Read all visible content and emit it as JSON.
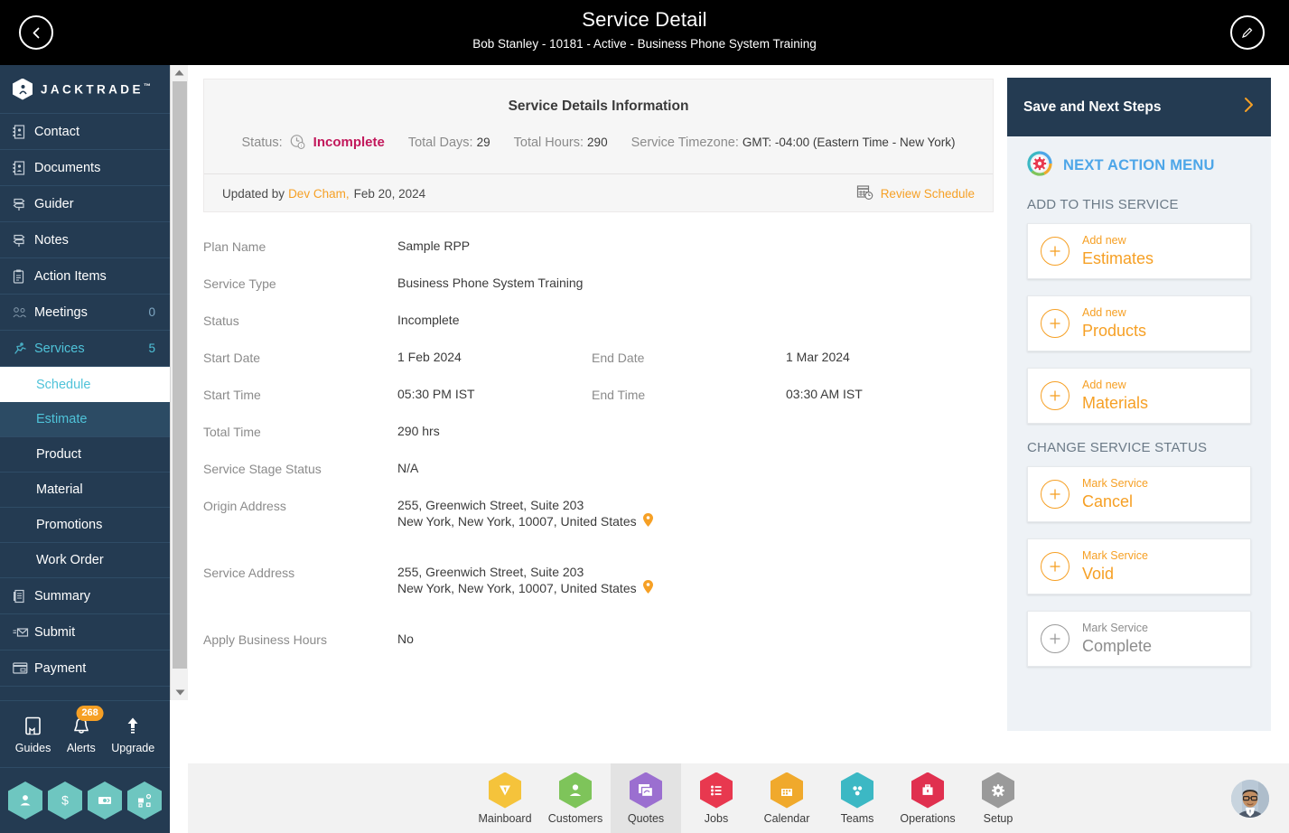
{
  "topbar": {
    "title": "Service Detail",
    "subtitle": "Bob Stanley - 10181 - Active - Business Phone System Training",
    "back_icon": "chevron-left-icon",
    "edit_icon": "pencil-icon"
  },
  "sidebar": {
    "brand": "JACKTRADE",
    "brand_tm": "™",
    "items": [
      {
        "label": "Contact",
        "count": ""
      },
      {
        "label": "Documents",
        "count": ""
      },
      {
        "label": "Guider",
        "count": ""
      },
      {
        "label": "Notes",
        "count": ""
      },
      {
        "label": "Action Items",
        "count": ""
      },
      {
        "label": "Meetings",
        "count": "0"
      },
      {
        "label": "Services",
        "count": "5"
      }
    ],
    "sub_items": [
      {
        "label": "Schedule"
      },
      {
        "label": "Estimate"
      },
      {
        "label": "Product"
      },
      {
        "label": "Material"
      },
      {
        "label": "Promotions"
      },
      {
        "label": "Work Order"
      }
    ],
    "items2": [
      {
        "label": "Summary"
      },
      {
        "label": "Submit"
      },
      {
        "label": "Payment"
      }
    ],
    "tools": [
      {
        "label": "Guides",
        "badge": ""
      },
      {
        "label": "Alerts",
        "badge": "268"
      },
      {
        "label": "Upgrade",
        "badge": ""
      }
    ],
    "hex_icons": [
      "user-icon",
      "dollar-icon",
      "cash-exchange-icon",
      "workflow-icon"
    ]
  },
  "info_card": {
    "title": "Service Details Information",
    "status_label": "Status:",
    "status_value": "Incomplete",
    "total_days_label": "Total Days:",
    "total_days_value": "29",
    "total_hours_label": "Total Hours:",
    "total_hours_value": "290",
    "timezone_label": "Service Timezone:",
    "timezone_value": "GMT: -04:00 (Eastern Time - New York)",
    "updated_by_label": "Updated by",
    "updated_by_name": "Dev Cham,",
    "updated_date": "Feb 20, 2024",
    "review_schedule": "Review Schedule"
  },
  "fields": {
    "plan_name_label": "Plan Name",
    "plan_name_value": "Sample RPP",
    "service_type_label": "Service Type",
    "service_type_value": "Business Phone System Training",
    "status_label": "Status",
    "status_value": "Incomplete",
    "start_date_label": "Start Date",
    "start_date_value": "1 Feb 2024",
    "end_date_label": "End Date",
    "end_date_value": "1 Mar 2024",
    "start_time_label": "Start Time",
    "start_time_value": "05:30 PM IST",
    "end_time_label": "End Time",
    "end_time_value": "03:30 AM IST",
    "total_time_label": "Total Time",
    "total_time_value": "290 hrs",
    "stage_status_label": "Service Stage Status",
    "stage_status_value": "N/A",
    "origin_address_label": "Origin Address",
    "origin_address_line1": "255, Greenwich Street, Suite 203",
    "origin_address_line2": "New York, New York, 10007, United States",
    "service_address_label": "Service Address",
    "service_address_line1": "255, Greenwich Street, Suite 203",
    "service_address_line2": "New York, New York, 10007, United States",
    "business_hours_label": "Apply Business Hours",
    "business_hours_value": "No"
  },
  "right_panel": {
    "header": "Save and Next Steps",
    "header_icon": "chevron-right-icon",
    "menu_title": "NEXT ACTION MENU",
    "menu_icon": "gear-refresh-icon",
    "section_add": "ADD TO THIS SERVICE",
    "add_cards": [
      {
        "top": "Add new",
        "bottom": "Estimates"
      },
      {
        "top": "Add new",
        "bottom": "Products"
      },
      {
        "top": "Add new",
        "bottom": "Materials"
      }
    ],
    "section_status": "CHANGE SERVICE STATUS",
    "status_cards": [
      {
        "top": "Mark Service",
        "bottom": "Cancel",
        "muted": false
      },
      {
        "top": "Mark Service",
        "bottom": "Void",
        "muted": false
      },
      {
        "top": "Mark Service",
        "bottom": "Complete",
        "muted": true
      }
    ]
  },
  "bottom_nav": {
    "items": [
      {
        "label": "Mainboard",
        "color": "#f5c33b",
        "icon": "shield-icon",
        "selected": false
      },
      {
        "label": "Customers",
        "color": "#7ec45a",
        "icon": "user-icon",
        "selected": false
      },
      {
        "label": "Quotes",
        "color": "#9b6fd0",
        "icon": "quote-stack-icon",
        "selected": true
      },
      {
        "label": "Jobs",
        "color": "#e8384f",
        "icon": "list-icon",
        "selected": false
      },
      {
        "label": "Calendar",
        "color": "#f0a92c",
        "icon": "calendar-icon",
        "selected": false
      },
      {
        "label": "Teams",
        "color": "#3cb8c4",
        "icon": "teams-icon",
        "selected": false
      },
      {
        "label": "Operations",
        "color": "#e0304f",
        "icon": "briefcase-icon",
        "selected": false
      },
      {
        "label": "Setup",
        "color": "#9a9a9a",
        "icon": "gear-icon",
        "selected": false
      }
    ]
  },
  "colors": {
    "accent_orange": "#f6a025",
    "sidebar_bg": "#243b52",
    "teal": "#4fc3d9",
    "crimson": "#c2185b",
    "panel_bg": "#eef2f6",
    "blue_link": "#4da6e8"
  }
}
